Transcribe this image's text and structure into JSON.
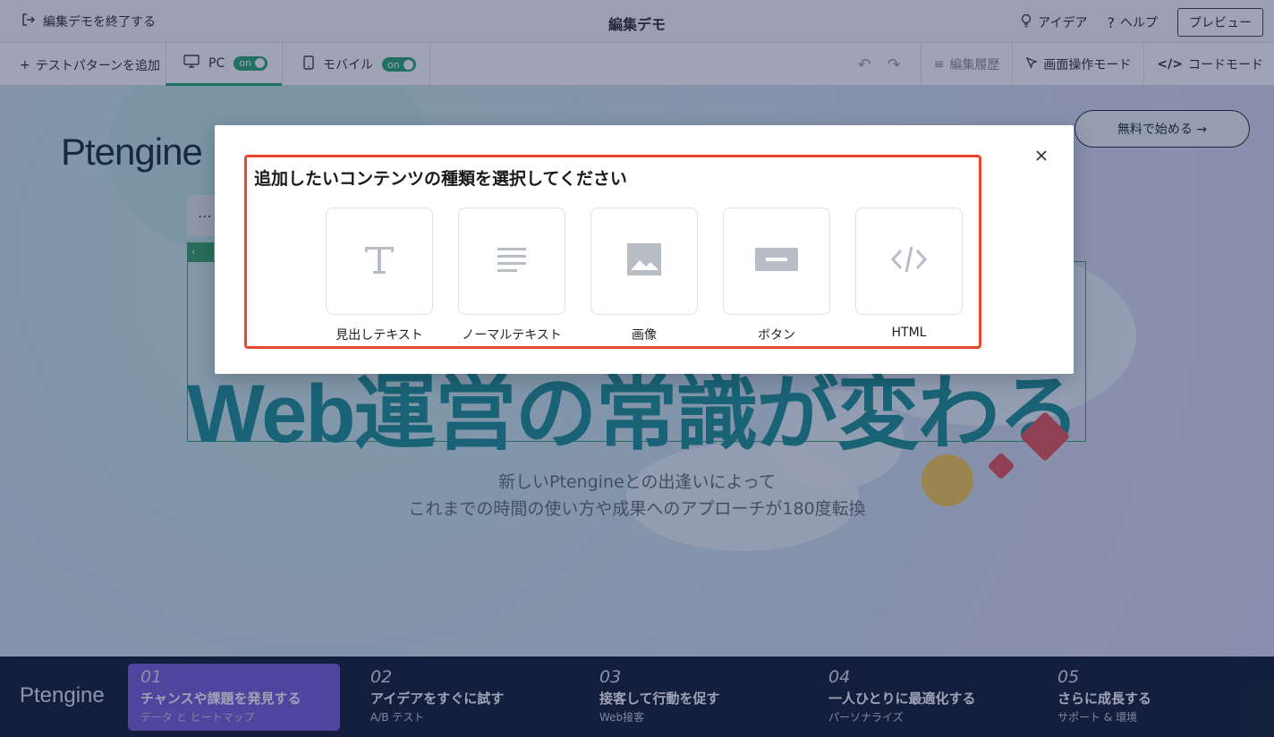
{
  "topbar": {
    "exit_label": "編集デモを終了する",
    "title": "編集デモ",
    "idea_label": "アイデア",
    "help_label": "ヘルプ",
    "preview_label": "プレビュー"
  },
  "toolbar": {
    "add_test_label": "テストパターンを追加",
    "devices": [
      {
        "label": "PC",
        "toggle": "on"
      },
      {
        "label": "モバイル",
        "toggle": "on"
      }
    ],
    "history_label": "編集履歴",
    "screen_mode_label": "画面操作モード",
    "code_mode_label": "コードモード"
  },
  "page": {
    "logo": "Ptengine",
    "free_button": "無料で始める →",
    "headline": "Web運営の常識が変わる",
    "subtext_line1": "新しいPtengineとの出逢いによって",
    "subtext_line2": "これまでの時間の使い方や成果へのアプローチが180度転換"
  },
  "bottom_nav": {
    "logo": "Ptengine",
    "steps": [
      {
        "num": "01",
        "label": "チャンスや課題を発見する",
        "sub": "データ と ヒートマップ"
      },
      {
        "num": "02",
        "label": "アイデアをすぐに試す",
        "sub": "A/B テスト"
      },
      {
        "num": "03",
        "label": "接客して行動を促す",
        "sub": "Web接客"
      },
      {
        "num": "04",
        "label": "一人ひとりに最適化する",
        "sub": "パーソナライズ"
      },
      {
        "num": "05",
        "label": "さらに成長する",
        "sub": "サポート & 環境"
      }
    ]
  },
  "modal": {
    "heading": "追加したいコンテンツの種類を選択してください",
    "options": [
      {
        "label": "見出しテキスト",
        "icon": "heading-text-icon"
      },
      {
        "label": "ノーマルテキスト",
        "icon": "normal-text-icon"
      },
      {
        "label": "画像",
        "icon": "image-icon"
      },
      {
        "label": "ボタン",
        "icon": "button-icon"
      },
      {
        "label": "HTML",
        "icon": "html-code-icon"
      }
    ]
  },
  "colors": {
    "highlight": "#e8462d",
    "toggle_on": "#1ea36c",
    "icon_gray": "#b8bcc4",
    "active_step": "#7352d6"
  }
}
